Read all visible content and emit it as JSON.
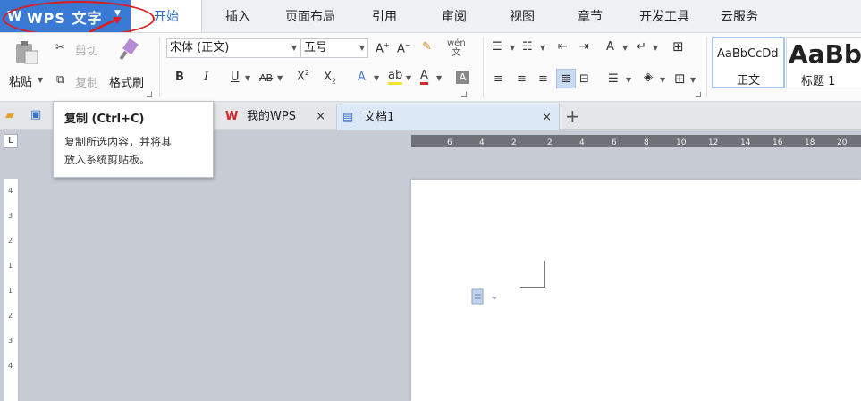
{
  "app": {
    "name": "WPS 文字"
  },
  "menu": {
    "tabs": [
      "开始",
      "插入",
      "页面布局",
      "引用",
      "审阅",
      "视图",
      "章节",
      "开发工具",
      "云服务"
    ],
    "active_tab": "开始"
  },
  "ribbon": {
    "clipboard": {
      "paste": "粘贴",
      "cut": "剪切",
      "copy": "复制",
      "format_painter": "格式刷"
    },
    "font": {
      "family": "宋体 (正文)",
      "size": "五号"
    },
    "styles": [
      {
        "preview": "AaBbCcDd",
        "label": "正文"
      },
      {
        "preview": "AaBb",
        "label": "标题 1"
      }
    ]
  },
  "tabs": {
    "home": "我的WPS",
    "document": "文档1"
  },
  "tooltip": {
    "title": "复制 (Ctrl+C)",
    "line1": "复制所选内容，并将其",
    "line2": "放入系统剪贴板。"
  },
  "colors": {
    "accent": "#3a7ad5",
    "annotation": "#e01b1b",
    "tab_active_text": "#2c6fd1"
  },
  "ruler": {
    "top_ticks": [
      "6",
      "4",
      "2",
      "2",
      "4",
      "6",
      "8",
      "10",
      "12",
      "14",
      "16",
      "18",
      "20"
    ],
    "left_ticks": [
      "4",
      "3",
      "2",
      "1",
      "1",
      "2",
      "3",
      "4"
    ]
  }
}
